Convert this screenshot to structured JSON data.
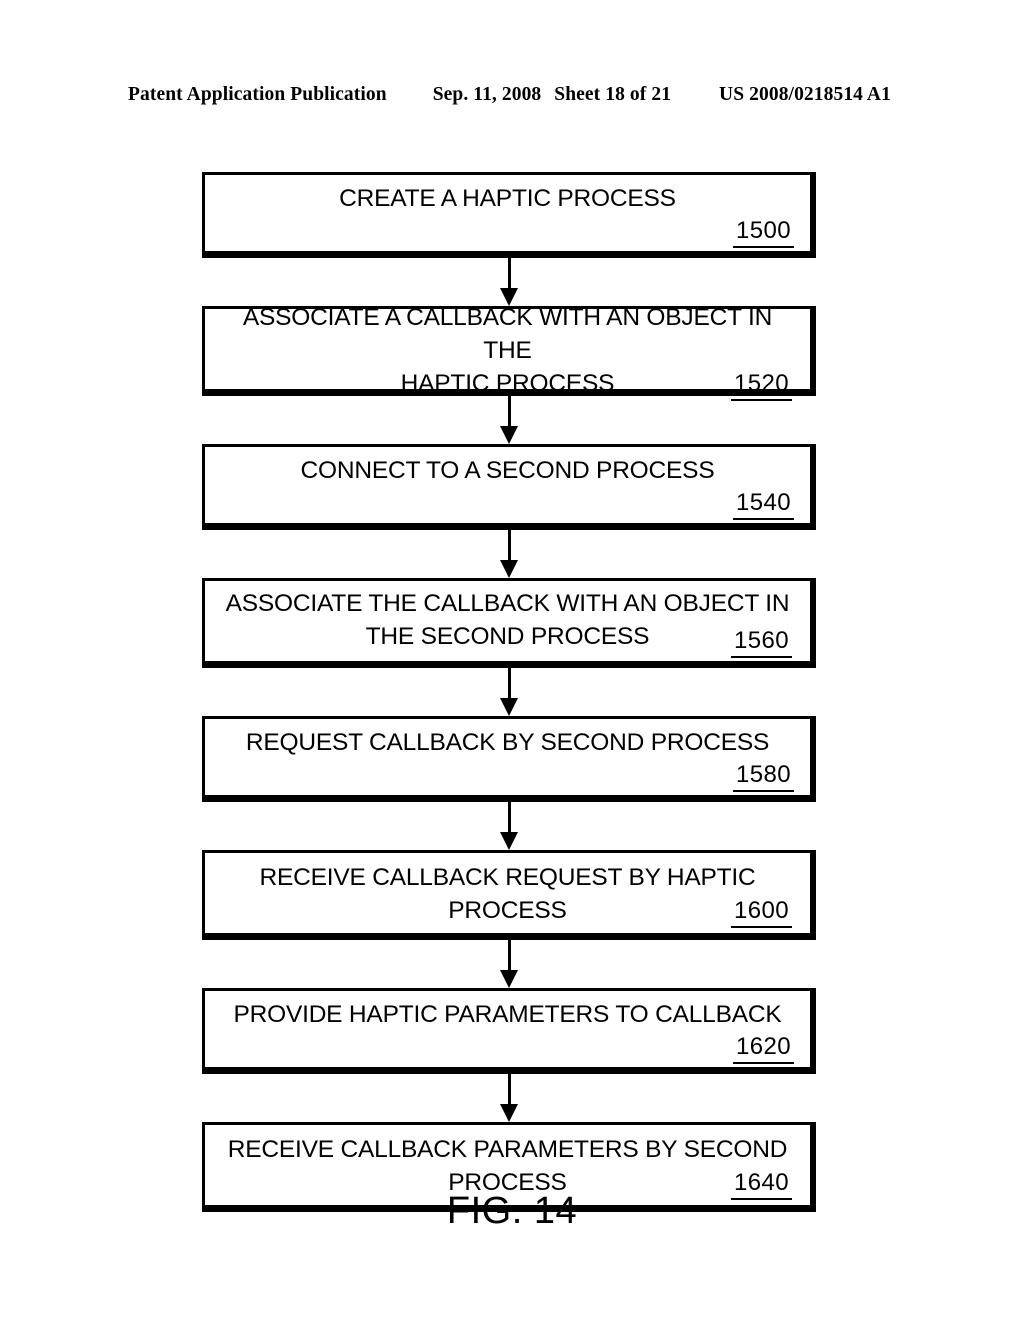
{
  "header": {
    "publication": "Patent Application Publication",
    "date": "Sep. 11, 2008",
    "sheet": "Sheet 18 of 21",
    "document_number": "US 2008/0218514 A1"
  },
  "figure": {
    "caption": "FIG. 14",
    "steps": [
      {
        "text": "CREATE A HAPTIC PROCESS",
        "ref": "1500",
        "lines": 1
      },
      {
        "text": "ASSOCIATE A CALLBACK WITH AN OBJECT IN THE\nHAPTIC PROCESS",
        "ref": "1520",
        "lines": 2
      },
      {
        "text": "CONNECT TO A SECOND PROCESS",
        "ref": "1540",
        "lines": 1
      },
      {
        "text": "ASSOCIATE THE CALLBACK WITH AN OBJECT IN\nTHE SECOND PROCESS",
        "ref": "1560",
        "lines": 2
      },
      {
        "text": "REQUEST CALLBACK BY SECOND PROCESS",
        "ref": "1580",
        "lines": 1
      },
      {
        "text": "RECEIVE CALLBACK REQUEST BY HAPTIC\nPROCESS",
        "ref": "1600",
        "lines": 2
      },
      {
        "text": "PROVIDE HAPTIC PARAMETERS TO CALLBACK",
        "ref": "1620",
        "lines": 1
      },
      {
        "text": "RECEIVE CALLBACK PARAMETERS BY SECOND\nPROCESS",
        "ref": "1640",
        "lines": 2
      }
    ],
    "connector_icon": "down-arrow-icon"
  },
  "style": {
    "ink": "#000000",
    "paper": "#ffffff"
  }
}
